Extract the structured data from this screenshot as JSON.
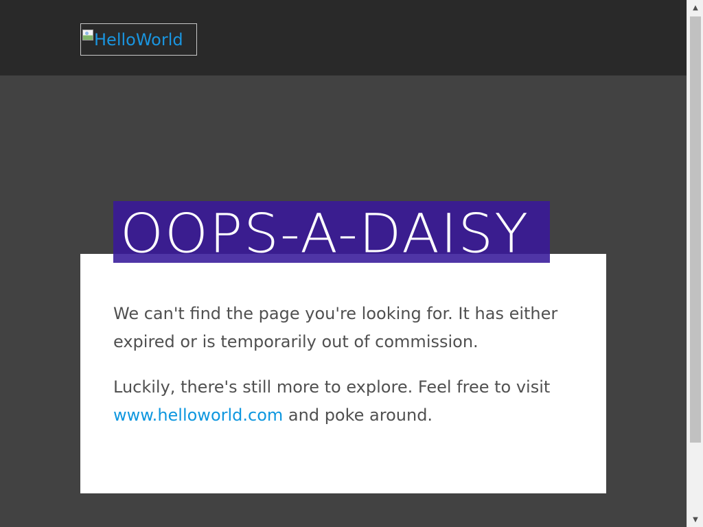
{
  "header": {
    "logo_alt": "HelloWorld"
  },
  "main": {
    "title": "OOPS-A-DAISY",
    "paragraph_1": "We can't find the page you're looking for. It has either expired or is temporarily out of commission.",
    "paragraph_2_before_link": "Luckily, there's still more to explore. Feel free to visit ",
    "home_link": "www.helloworld.com",
    "paragraph_2_after_link": " and poke around."
  },
  "scrollbar": {
    "up_arrow": "▲",
    "down_arrow": "▼"
  },
  "colors": {
    "header_background": "#292929",
    "page_background": "#424242",
    "card_background": "#ffffff",
    "title_background": "#3a1d8f",
    "link": "#0e97df",
    "body_text": "#505050"
  }
}
